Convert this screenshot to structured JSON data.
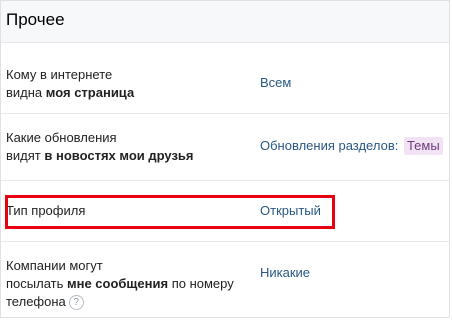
{
  "header": {
    "title": "Прочее"
  },
  "rows": [
    {
      "label_line1": "Кому в интернете",
      "label_line2_plain": "видна ",
      "label_line2_bold": "моя страница",
      "value": "Всем"
    },
    {
      "label_line1": "Какие обновления",
      "label_line2_plain": "видят ",
      "label_line2_bold": "в новостях мои друзья",
      "value": "Обновления разделов:",
      "value_tag": "Темы"
    },
    {
      "label": "Тип профиля",
      "value": "Открытый"
    },
    {
      "label_line1": "Компании могут",
      "label_line2_plain": "посылать ",
      "label_line2_bold": "мне сообщения",
      "label_line2_rest": " по номеру",
      "label_line3": "телефона",
      "help_icon_glyph": "?",
      "value": "Никакие"
    }
  ],
  "highlight_color": "#e60012",
  "link_color": "#2a5885"
}
